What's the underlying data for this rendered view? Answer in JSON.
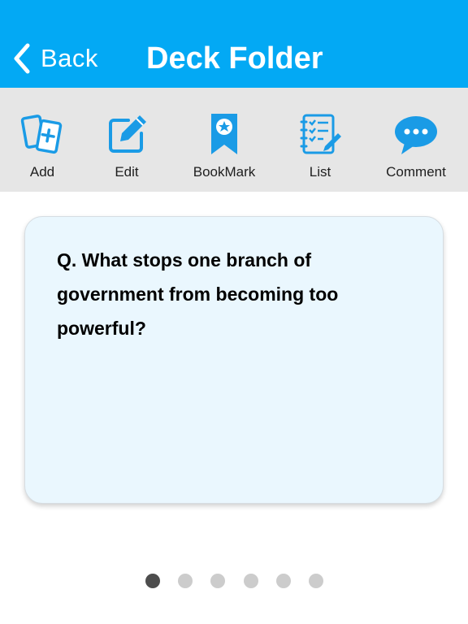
{
  "header": {
    "back_label": "Back",
    "title": "Deck Folder",
    "background_color": "#03a9f4"
  },
  "toolbar": {
    "items": [
      {
        "label": "Add",
        "icon": "add-card-icon"
      },
      {
        "label": "Edit",
        "icon": "edit-icon"
      },
      {
        "label": "BookMark",
        "icon": "bookmark-icon"
      },
      {
        "label": "List",
        "icon": "list-icon"
      },
      {
        "label": "Comment",
        "icon": "comment-icon"
      }
    ],
    "icon_color": "#1a9be6"
  },
  "card": {
    "question": "Q. What stops one branch of government from becoming too powerful?"
  },
  "pager": {
    "page_count": 6,
    "current_page": 1
  }
}
